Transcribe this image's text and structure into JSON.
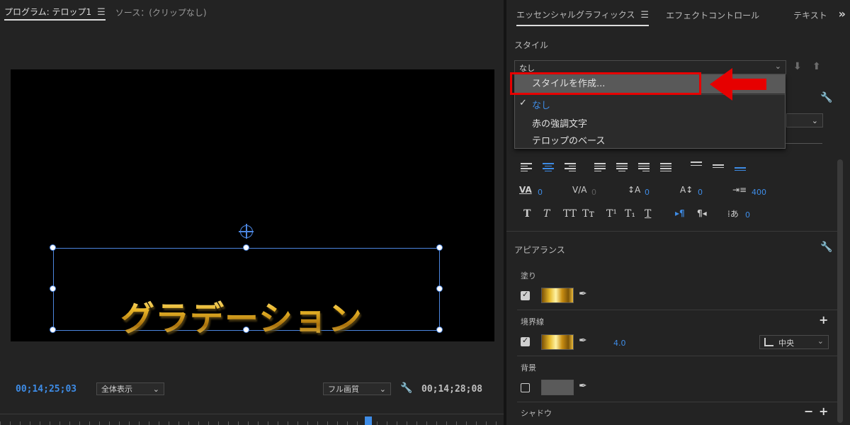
{
  "program_monitor": {
    "tab_program": "プログラム: テロップ1",
    "tab_source": "ソース：(クリップなし)",
    "title_text": "グラデーション",
    "timecode_current": "00;14;25;03",
    "timecode_duration": "00;14;28;08",
    "zoom_select": "全体表示",
    "quality_select": "フル画質"
  },
  "essential_graphics": {
    "tabs": [
      "エッセンシャルグラフィックス",
      "エフェクトコントロール",
      "テキスト"
    ],
    "style_label": "スタイル",
    "style_value": "なし",
    "style_menu": {
      "create": "スタイルを作成...",
      "items": [
        "なし",
        "赤の強調文字",
        "テロップのベース"
      ],
      "selected": "なし"
    },
    "text_tools": {
      "kerning": "0",
      "tracking": "0",
      "leading": "0",
      "baseline": "0",
      "tab_width": "400",
      "tsume": "0"
    },
    "appearance": {
      "header": "アピアランス",
      "fill_label": "塗り",
      "stroke_label": "境界線",
      "stroke_width": "4.0",
      "stroke_position": "中央",
      "background_label": "背景",
      "shadow_label": "シャドウ"
    }
  },
  "colors": {
    "accent": "#3e8ce6",
    "highlight": "#e60000",
    "panel_bg": "#232323"
  }
}
